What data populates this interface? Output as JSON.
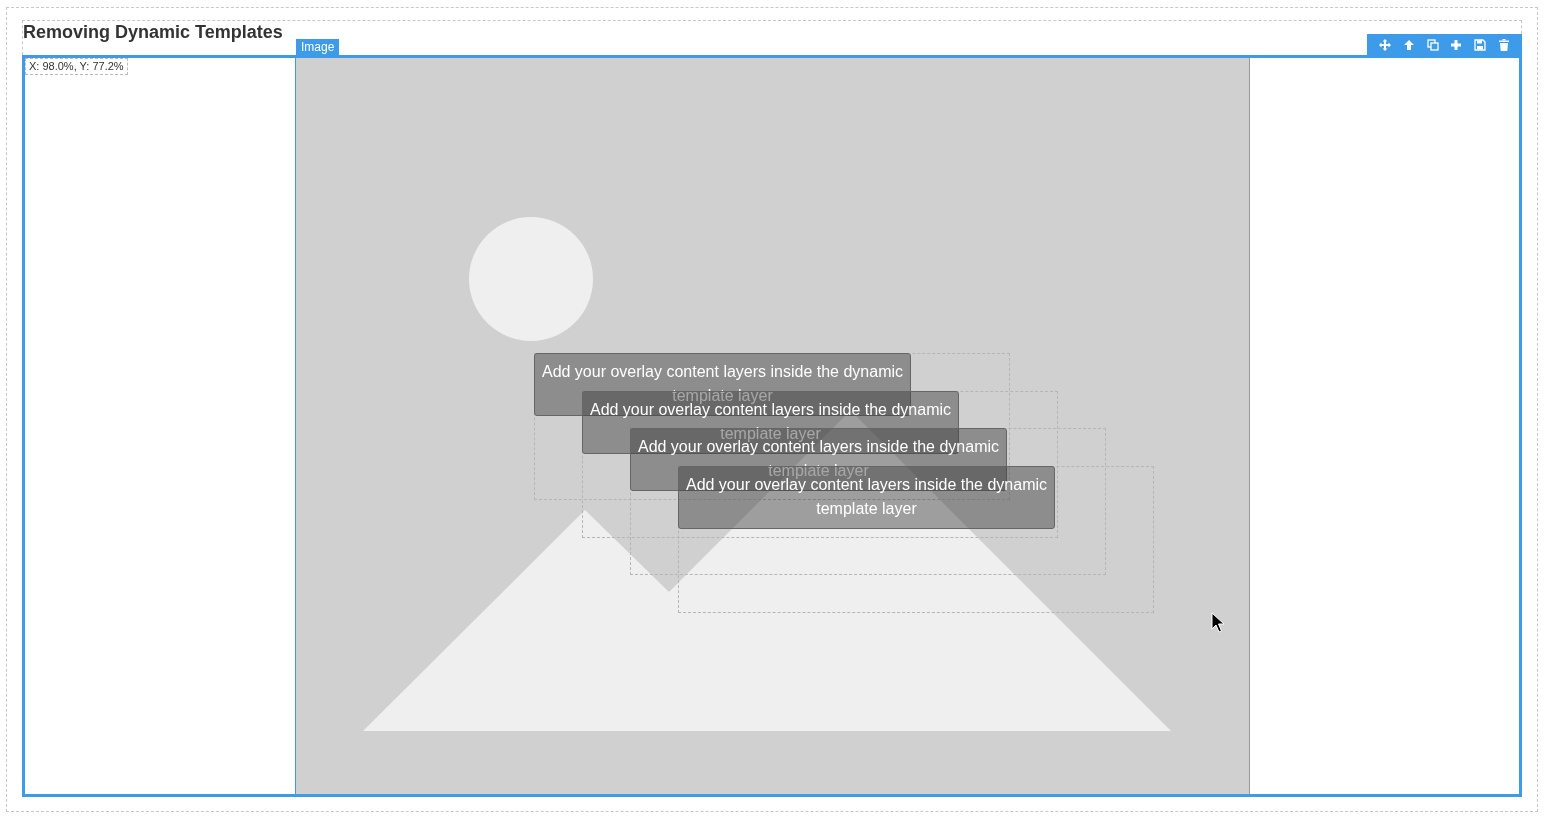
{
  "title": "Removing Dynamic Templates",
  "image_tab": "Image",
  "coordinates": "X: 98.0%, Y: 77.2%",
  "overlays": [
    {
      "text": "Add your overlay content layers inside the dynamic template layer"
    },
    {
      "text": "Add your overlay content layers inside the dynamic template layer"
    },
    {
      "text": "Add your overlay content layers inside the dynamic template layer"
    },
    {
      "text": "Add your overlay content layers inside the dynamic template layer"
    }
  ]
}
